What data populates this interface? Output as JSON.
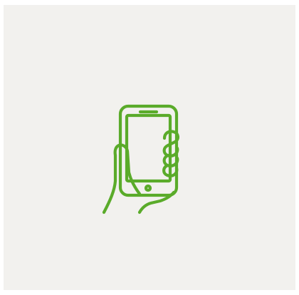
{
  "illustration": {
    "icon": "hand-holding-phone-icon",
    "stroke_color": "#5aab2a",
    "background_color": "#f2f1ee"
  }
}
